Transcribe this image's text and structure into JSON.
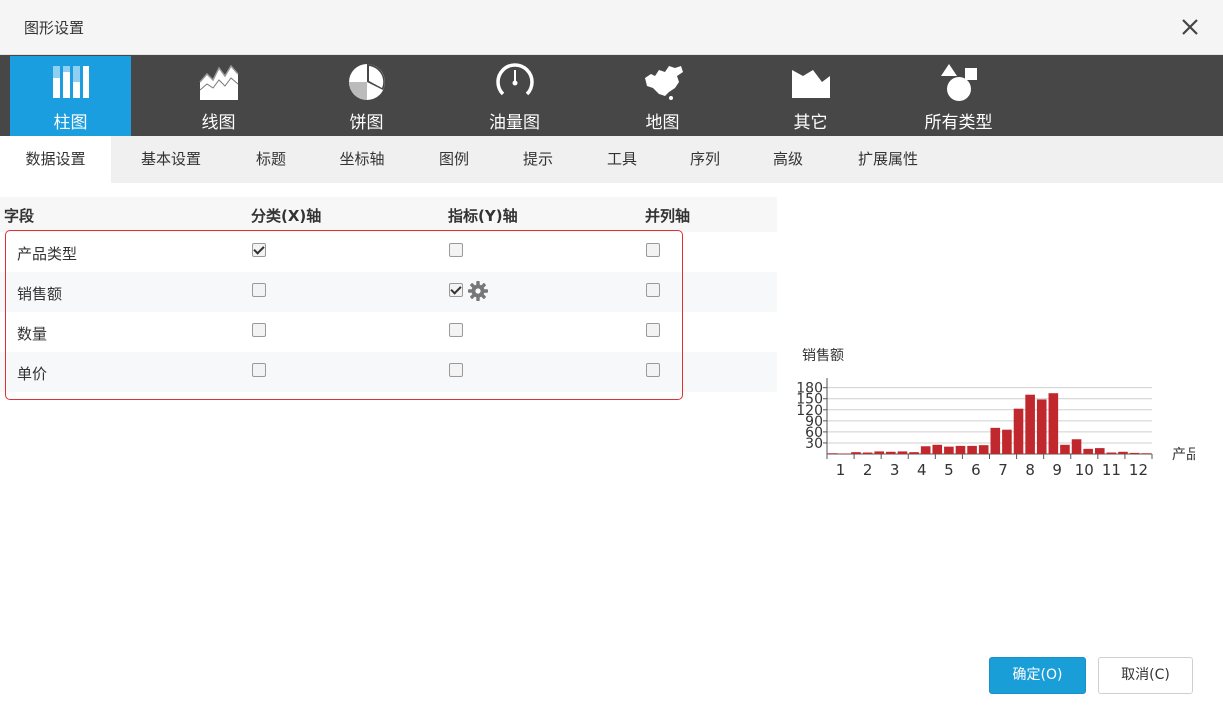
{
  "dialog": {
    "title": "图形设置"
  },
  "chart_types": [
    {
      "label": "柱图",
      "icon": "bar-chart-icon",
      "active": true
    },
    {
      "label": "线图",
      "icon": "line-chart-icon",
      "active": false
    },
    {
      "label": "饼图",
      "icon": "pie-chart-icon",
      "active": false
    },
    {
      "label": "油量图",
      "icon": "gauge-icon",
      "active": false
    },
    {
      "label": "地图",
      "icon": "china-map-icon",
      "active": false
    },
    {
      "label": "其它",
      "icon": "area-chart-icon",
      "active": false
    },
    {
      "label": "所有类型",
      "icon": "shapes-icon",
      "active": false
    }
  ],
  "tabs": [
    {
      "label": "数据设置",
      "active": true
    },
    {
      "label": "基本设置"
    },
    {
      "label": "标题"
    },
    {
      "label": "坐标轴"
    },
    {
      "label": "图例"
    },
    {
      "label": "提示"
    },
    {
      "label": "工具"
    },
    {
      "label": "序列"
    },
    {
      "label": "高级"
    },
    {
      "label": "扩展属性"
    }
  ],
  "fields": {
    "headers": [
      "字段",
      "分类(X)轴",
      "指标(Y)轴",
      "并列轴"
    ],
    "rows": [
      {
        "name": "产品类型",
        "x": true,
        "y": false,
        "parallel": false
      },
      {
        "name": "销售额",
        "x": false,
        "y": true,
        "parallel": false,
        "y_settings": true
      },
      {
        "name": "数量",
        "x": false,
        "y": false,
        "parallel": false
      },
      {
        "name": "单价",
        "x": false,
        "y": false,
        "parallel": false
      }
    ]
  },
  "chart_data": {
    "type": "bar",
    "title": "",
    "series_label": "销售额",
    "xlabel": "产品",
    "ylabel": "",
    "x_ticks": [
      "1",
      "2",
      "3",
      "4",
      "5",
      "6",
      "7",
      "8",
      "9",
      "10",
      "11",
      "12"
    ],
    "y_ticks": [
      30,
      60,
      90,
      120,
      150,
      180
    ],
    "ylim": [
      0,
      190
    ],
    "grid": true,
    "bar_color": "#c0282d",
    "values": [
      2,
      1,
      5,
      4,
      7,
      6,
      7,
      5,
      21,
      25,
      20,
      22,
      22,
      24,
      71,
      66,
      123,
      161,
      148,
      165,
      25,
      40,
      14,
      16,
      4,
      6,
      3,
      2
    ]
  },
  "buttons": {
    "ok": "确定(O)",
    "cancel": "取消(C)"
  },
  "colors": {
    "accent": "#1a9ee0",
    "toolbar": "#474747",
    "highlight": "#e03030"
  }
}
